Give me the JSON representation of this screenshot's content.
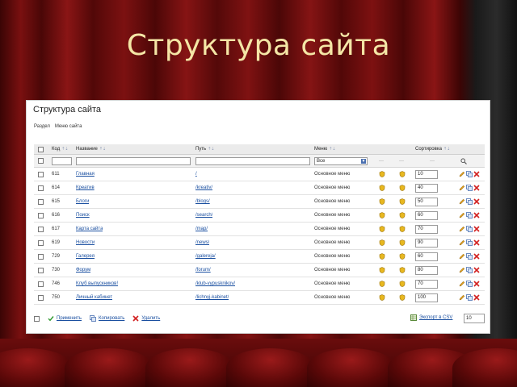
{
  "slide": {
    "title": "Структура сайта"
  },
  "panel": {
    "title": "Структура сайта",
    "tabs": [
      "Раздел",
      "Меню сайта"
    ]
  },
  "columns": {
    "code": "Код",
    "name": "Название",
    "path": "Путь",
    "menu": "Меню",
    "sort": "Сортировка"
  },
  "filter": {
    "menu_value": "Все"
  },
  "rows": [
    {
      "code": "611",
      "name": "Главная",
      "path": "/",
      "menu": "Основное меню",
      "sort": "10"
    },
    {
      "code": "614",
      "name": "Креатив",
      "path": "/kreativ/",
      "menu": "Основное меню",
      "sort": "40"
    },
    {
      "code": "615",
      "name": "Блоги",
      "path": "/blogs/",
      "menu": "Основное меню",
      "sort": "50"
    },
    {
      "code": "616",
      "name": "Поиск",
      "path": "/search/",
      "menu": "Основное меню",
      "sort": "60"
    },
    {
      "code": "617",
      "name": "Карта сайта",
      "path": "/map/",
      "menu": "Основное меню",
      "sort": "70"
    },
    {
      "code": "619",
      "name": "Новости",
      "path": "/news/",
      "menu": "Основное меню",
      "sort": "90"
    },
    {
      "code": "729",
      "name": "Галерея",
      "path": "/galereja/",
      "menu": "Основное меню",
      "sort": "60"
    },
    {
      "code": "730",
      "name": "Форум",
      "path": "/forum/",
      "menu": "Основное меню",
      "sort": "80"
    },
    {
      "code": "746",
      "name": "Клуб выпускников!",
      "path": "/klub-vypusknikov/",
      "menu": "Основное меню",
      "sort": "70"
    },
    {
      "code": "750",
      "name": "Личный кабинет",
      "path": "/lichnyj-kabinet/",
      "menu": "Основное меню",
      "sort": "100"
    }
  ],
  "footer": {
    "apply": "Применить",
    "copy": "Копировать",
    "delete": "Удалить",
    "export": "Экспорт в CSV",
    "page_size": "10"
  },
  "colors": {
    "link": "#1a4fa0",
    "title": "#f4e6a6",
    "delete": "#d22020",
    "edit": "#e0a020"
  }
}
